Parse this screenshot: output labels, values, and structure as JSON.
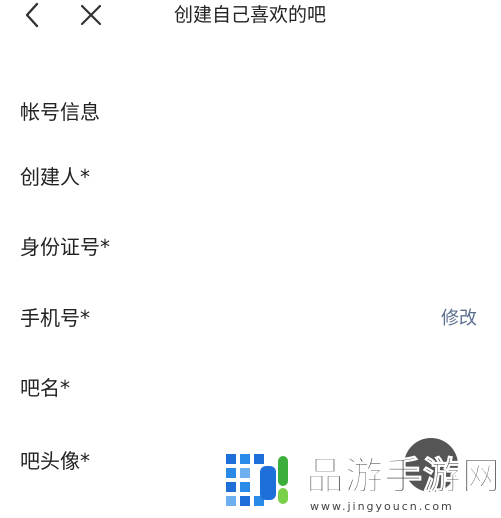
{
  "header": {
    "title": "创建自己喜欢的吧",
    "back_icon": "chevron-left-icon",
    "close_icon": "close-icon"
  },
  "account_section": {
    "title": "帐号信息",
    "rows": [
      {
        "label": "创建人*"
      },
      {
        "label": "身份证号*"
      },
      {
        "label": "手机号*",
        "action": "修改"
      },
      {
        "label": "吧名*"
      },
      {
        "label": "吧头像*"
      }
    ]
  },
  "watermark": {
    "brand": "晶游手游网",
    "url": "www.jingyoucn.com"
  },
  "colors": {
    "action_link": "#5b6f8f",
    "text_primary": "#222222",
    "watermark_blue": "#1e6fd9",
    "watermark_green": "#3cae3c"
  }
}
